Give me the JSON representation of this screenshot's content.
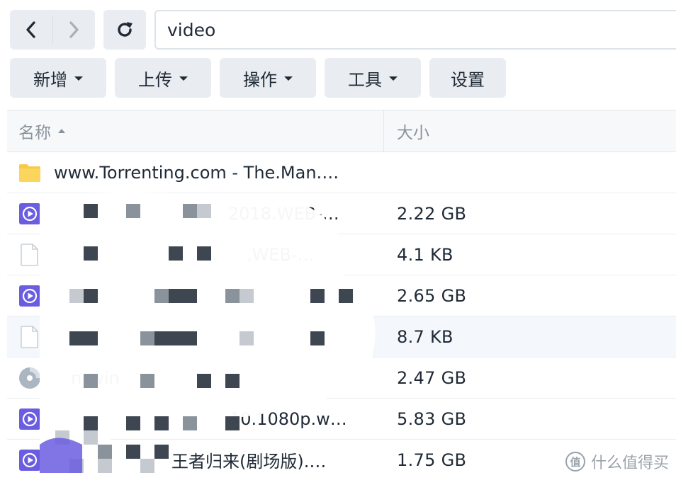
{
  "nav": {
    "path_value": "video"
  },
  "toolbar": {
    "new_label": "新增",
    "upload_label": "上传",
    "action_label": "操作",
    "tools_label": "工具",
    "settings_label": "设置"
  },
  "list": {
    "columns": {
      "name": "名称",
      "size": "大小"
    },
    "rows": [
      {
        "icon": "folder-icon",
        "name": "www.Torrenting.com - The.Man.…",
        "size": ""
      },
      {
        "icon": "video-file-icon",
        "name": "2018.WEB-…",
        "size": "2.22 GB"
      },
      {
        "icon": "document-file-icon",
        "name": ".WEB-…",
        "size": "4.1 KB"
      },
      {
        "icon": "video-file-icon",
        "name": "",
        "size": "2.65 GB"
      },
      {
        "icon": "document-file-icon",
        "name": "",
        "size": "8.7 KB"
      },
      {
        "icon": "disc-image-icon",
        "name": "n_win",
        "size": "2.47 GB"
      },
      {
        "icon": "video-file-icon",
        "name": "10.1080p.w…",
        "size": "5.83 GB"
      },
      {
        "icon": "video-file-icon",
        "name": "王者归来(剧场版).…",
        "size": "1.75 GB"
      }
    ]
  },
  "watermark": {
    "logo": "值",
    "text": "什么值得买"
  },
  "colors": {
    "folder": "#f7c948",
    "video": "#6b5de0",
    "button_bg": "#e9edf1"
  }
}
